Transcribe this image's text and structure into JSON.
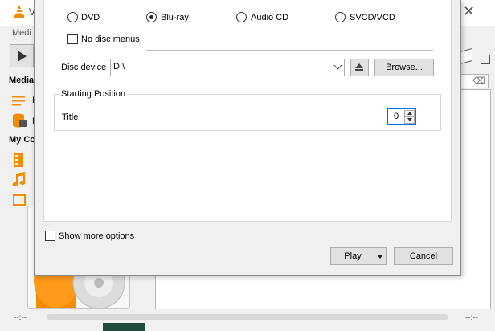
{
  "app": {
    "title": "V",
    "menu_media": "Medi"
  },
  "sidebar": {
    "media_header": "Media",
    "my_computer_header": "My Co",
    "item1_label": "F",
    "item2_label": "N",
    "icons": [
      "playlist-icon",
      "media-library-icon",
      "videos-icon",
      "music-icon",
      "pictures-icon"
    ]
  },
  "main": {
    "time_elapsed": "--:--",
    "time_total": "--:--"
  },
  "dialog": {
    "disc_selection": {
      "options": [
        "DVD",
        "Blu-ray",
        "Audio CD",
        "SVCD/VCD"
      ],
      "selected": "Blu-ray",
      "no_disc_menus_label": "No disc menus",
      "no_disc_menus_checked": false,
      "disc_device_label": "Disc device",
      "disc_device_value": "D:\\",
      "browse_label": "Browse..."
    },
    "starting_position": {
      "legend": "Starting Position",
      "title_label": "Title",
      "title_value": "0"
    },
    "show_more_options_label": "Show more options",
    "show_more_options_checked": false,
    "play_label": "Play",
    "cancel_label": "Cancel"
  },
  "colors": {
    "accent_orange": "#f28c00",
    "focus_blue": "#0078d7"
  }
}
